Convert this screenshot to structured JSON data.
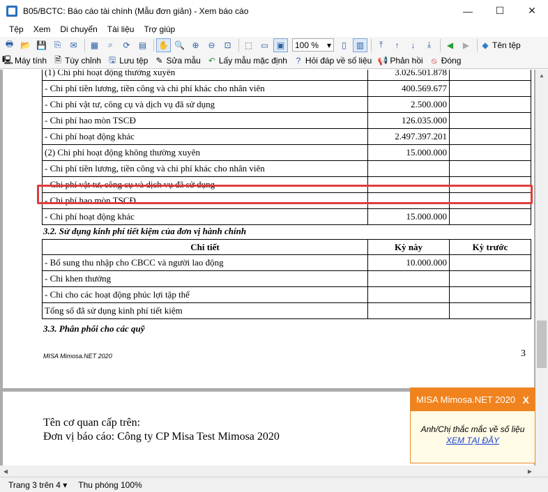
{
  "window": {
    "title": "B05/BCTC: Báo cáo tài chính (Mẫu đơn giản) - Xem báo cáo",
    "controls": {
      "minimize": "—",
      "maximize": "☐",
      "close": "✕"
    }
  },
  "menu": [
    "Tệp",
    "Xem",
    "Di chuyển",
    "Tài liệu",
    "Trợ giúp"
  ],
  "toolbar1": {
    "zoom_value": "100 %",
    "file_name_label": "Tên tệp"
  },
  "toolbar2": {
    "computer": "Máy tính",
    "customize": "Tùy chỉnh",
    "save_file": "Lưu tệp",
    "edit_template": "Sửa mẫu",
    "default_template": "Lấy mẫu mặc định",
    "data_qa": "Hỏi đáp về số liệu",
    "feedback": "Phản hồi",
    "close": "Đóng"
  },
  "table1": {
    "rows": [
      {
        "label": "(1) Chi phí hoạt động thường xuyên",
        "value": "3.026.501.878"
      },
      {
        "label": "- Chi phí tiền lương, tiền công và chi phí khác cho nhân viên",
        "value": "400.569.677"
      },
      {
        "label": "- Chi phí vật tư, công cụ và dịch vụ đã sử dụng",
        "value": "2.500.000"
      },
      {
        "label": "- Chi phí hao mòn TSCĐ",
        "value": "126.035.000"
      },
      {
        "label": "- Chi phí hoạt động khác",
        "value": "2.497.397.201"
      },
      {
        "label": "(2) Chi phí hoạt động không thường xuyên",
        "value": "15.000.000"
      },
      {
        "label": "- Chi phí tiền lương, tiền công và chi phí khác cho nhân viên",
        "value": ""
      },
      {
        "label": "- Chi phí vật tư, công cụ và dịch vụ đã sử dụng",
        "value": ""
      },
      {
        "label": "- Chi phí hao mòn TSCĐ",
        "value": ""
      },
      {
        "label": "- Chi phí hoạt động khác",
        "value": "15.000.000"
      }
    ]
  },
  "section32": "3.2. Sử dụng kinh phí tiết kiệm của đơn vị hành chính",
  "table2": {
    "headers": [
      "Chi tiết",
      "Kỳ này",
      "Kỳ trước"
    ],
    "rows": [
      {
        "label": "- Bổ sung thu nhập cho CBCC và người lao động",
        "this": "10.000.000",
        "prev": ""
      },
      {
        "label": "- Chi khen thưởng",
        "this": "",
        "prev": ""
      },
      {
        "label": "- Chi cho các hoạt động phúc lợi tập thể",
        "this": "",
        "prev": ""
      },
      {
        "label": "Tổng số đã sử dụng kinh phí tiết kiệm",
        "this": "",
        "prev": ""
      }
    ]
  },
  "section33": "3.3. Phân phối cho các quỹ",
  "footer_brand": "MISA Mimosa.NET 2020",
  "page_number": "3",
  "page2": {
    "line1": "Tên cơ quan cấp trên:",
    "line2": "Đơn vị báo cáo: Công ty CP Misa Test Mimosa 2020"
  },
  "popup": {
    "title": "MISA Mimosa.NET 2020",
    "close": "X",
    "text": "Anh/Chị thắc mắc về số liệu",
    "link": "XEM TẠI ĐÂY"
  },
  "status": {
    "page": "Trang 3 trên 4 ▾",
    "zoom": "Thu phóng 100%"
  }
}
